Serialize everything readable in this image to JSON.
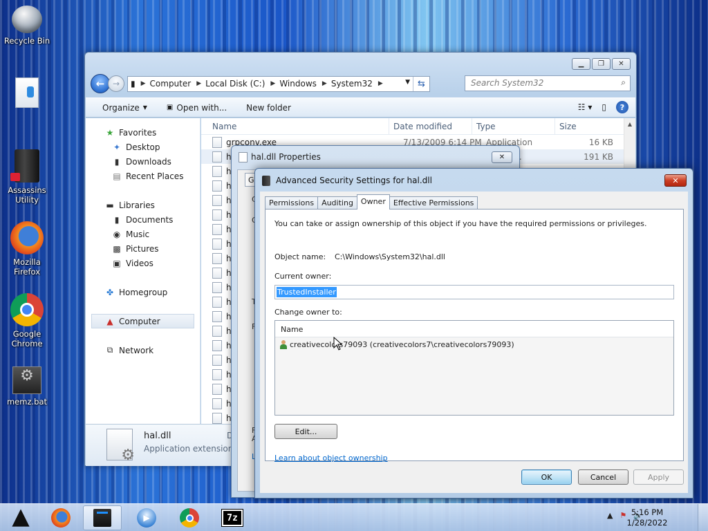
{
  "desktop": {
    "icons": [
      {
        "label": "Recycle Bin"
      },
      {
        "label": ""
      },
      {
        "label": "Assassins Utility"
      },
      {
        "label": "Mozilla Firefox"
      },
      {
        "label": "Google Chrome"
      },
      {
        "label": "memz.bat"
      }
    ]
  },
  "explorer": {
    "breadcrumb": [
      "Computer",
      "Local Disk (C:)",
      "Windows",
      "System32"
    ],
    "search_placeholder": "Search System32",
    "toolbar": {
      "organize": "Organize",
      "open_with": "Open with...",
      "new_folder": "New folder"
    },
    "nav": {
      "favorites": "Favorites",
      "desktop": "Desktop",
      "downloads": "Downloads",
      "recent": "Recent Places",
      "libraries": "Libraries",
      "documents": "Documents",
      "music": "Music",
      "pictures": "Pictures",
      "videos": "Videos",
      "homegroup": "Homegroup",
      "computer": "Computer",
      "network": "Network"
    },
    "columns": {
      "name": "Name",
      "date": "Date modified",
      "type": "Type",
      "size": "Size"
    },
    "rows": [
      {
        "name": "grpconv.exe",
        "date": "7/13/2009 6:14 PM",
        "type": "Application",
        "size": "16 KB"
      },
      {
        "name": "h",
        "date": "",
        "type": "extens...",
        "size": "191 KB"
      },
      {
        "name": "h"
      },
      {
        "name": "h"
      },
      {
        "name": "h"
      },
      {
        "name": "h"
      },
      {
        "name": "h"
      },
      {
        "name": "h"
      },
      {
        "name": "h"
      },
      {
        "name": "h"
      },
      {
        "name": "h"
      },
      {
        "name": "h"
      },
      {
        "name": "h"
      },
      {
        "name": "h"
      },
      {
        "name": "h"
      },
      {
        "name": "h"
      },
      {
        "name": "h"
      },
      {
        "name": "h"
      },
      {
        "name": "h"
      },
      {
        "name": "h"
      }
    ],
    "details": {
      "name": "hal.dll",
      "type": "Application extension",
      "cut_label": "D"
    }
  },
  "properties": {
    "title": "hal.dll Properties",
    "tab_partial": "Ge",
    "edge_glyphs": [
      "C",
      "G",
      "T",
      "F",
      "F",
      "A",
      "L"
    ]
  },
  "advanced": {
    "title": "Advanced Security Settings for hal.dll",
    "tabs": [
      "Permissions",
      "Auditing",
      "Owner",
      "Effective Permissions"
    ],
    "active_tab": "Owner",
    "intro": "You can take or assign ownership of this object if you have the required permissions or privileges.",
    "object_name_label": "Object name:",
    "object_name_value": "C:\\Windows\\System32\\hal.dll",
    "current_owner_label": "Current owner:",
    "current_owner_value": "TrustedInstaller",
    "change_owner_label": "Change owner to:",
    "list_header": "Name",
    "list_rows": [
      "creativecolors79093 (creativecolors7\\creativecolors79093)"
    ],
    "edit_button": "Edit...",
    "learn_link": "Learn about object ownership",
    "ok": "OK",
    "cancel": "Cancel",
    "apply": "Apply"
  },
  "taskbar": {
    "time": "5:16 PM",
    "date": "1/28/2022",
    "tray_up": "▲"
  }
}
